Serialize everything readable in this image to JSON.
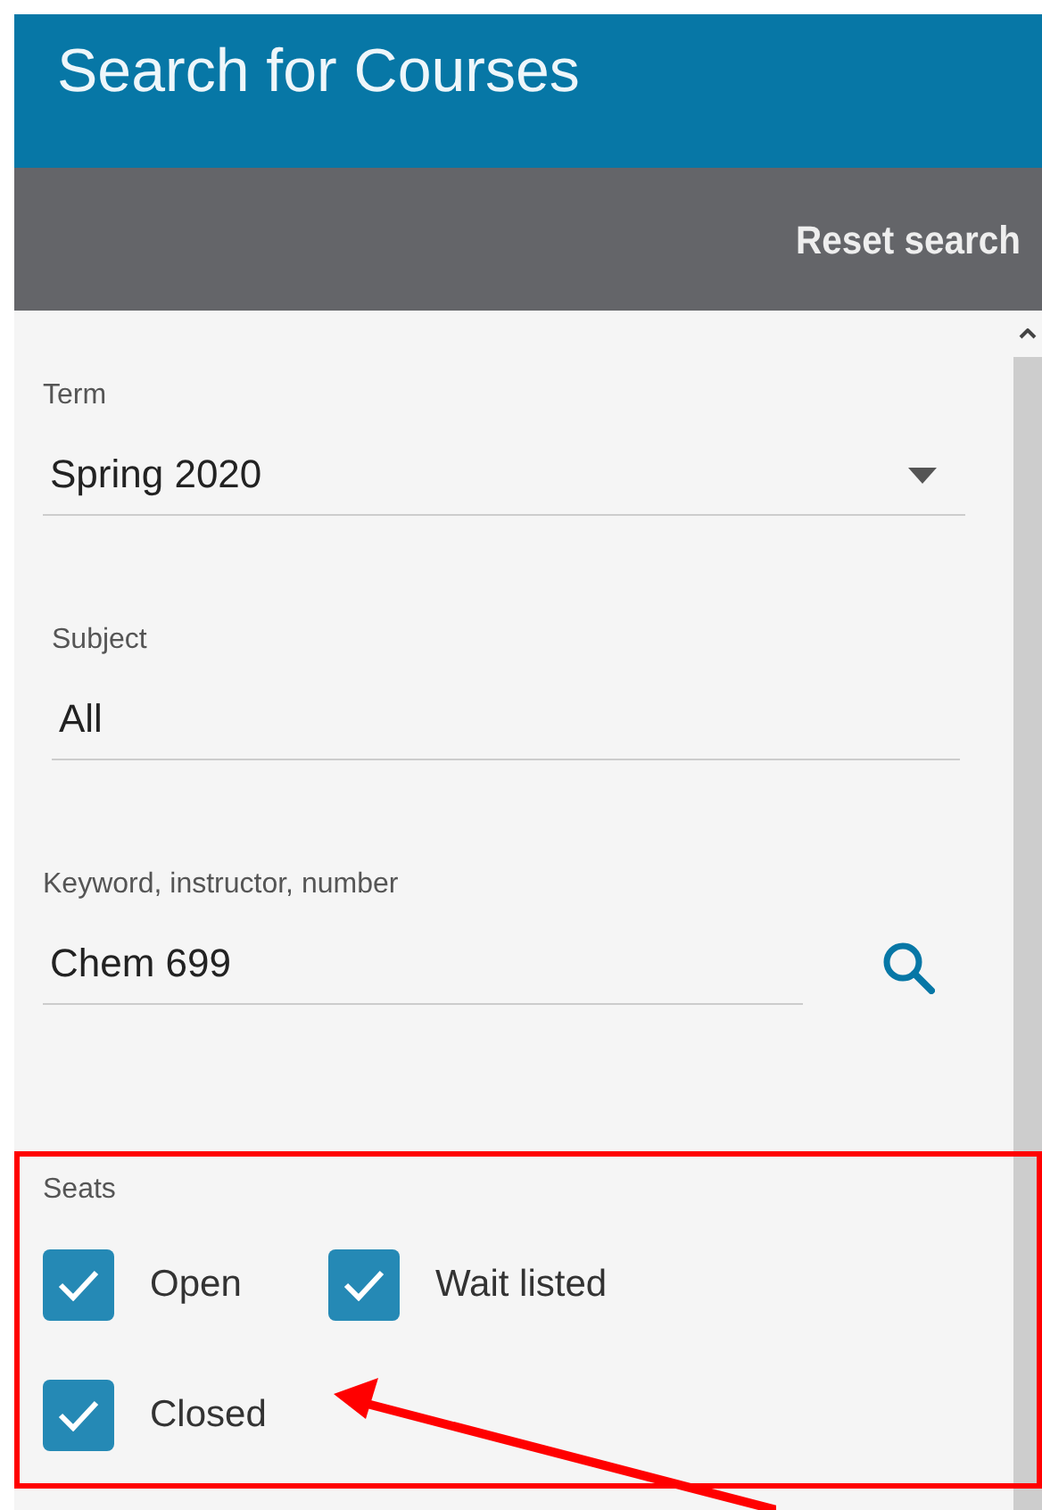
{
  "header": {
    "title": "Search for Courses"
  },
  "toolbar": {
    "reset_link": "Reset search"
  },
  "fields": [
    {
      "kind": "select",
      "label": "Term",
      "value": "Spring 2020"
    },
    {
      "kind": "text",
      "label": "Subject",
      "value": "All"
    },
    {
      "kind": "search",
      "label": "Keyword, instructor, number",
      "value": "Chem 699"
    }
  ],
  "seats": {
    "label": "Seats",
    "options": [
      {
        "label": "Open",
        "checked": true
      },
      {
        "label": "Wait listed",
        "checked": true
      },
      {
        "label": "Closed",
        "checked": true
      }
    ]
  }
}
